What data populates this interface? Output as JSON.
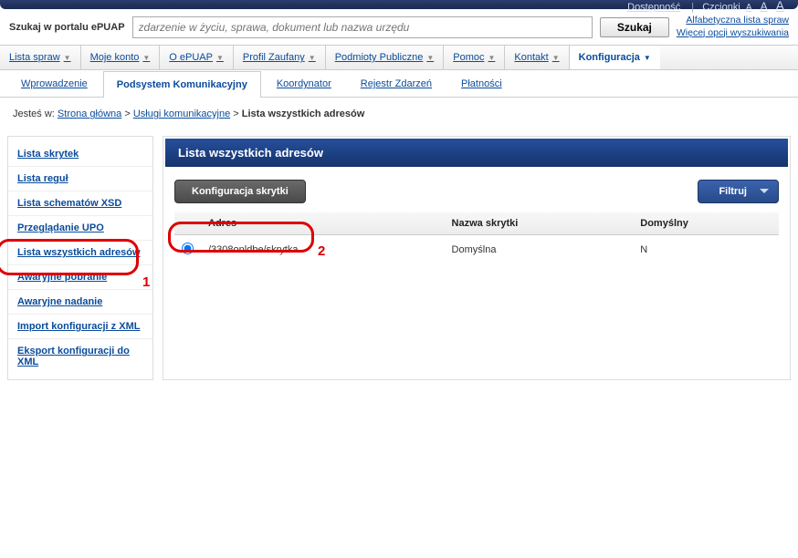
{
  "top": {
    "accessibility": "Dostępność",
    "fonts": "Czcionki",
    "font_a1": "A",
    "font_a2": "A",
    "font_a3": "A"
  },
  "search": {
    "label": "Szukaj w portalu ePUAP",
    "placeholder": "zdarzenie w życiu, sprawa, dokument lub nazwa urzędu",
    "button": "Szukaj",
    "alpha": "Alfabetyczna lista spraw",
    "more": "Więcej opcji wyszukiwania"
  },
  "nav1": {
    "items": [
      "Lista spraw",
      "Moje konto",
      "O ePUAP",
      "Profil Zaufany",
      "Podmioty Publiczne",
      "Pomoc",
      "Kontakt",
      "Konfiguracja"
    ]
  },
  "nav2": {
    "items": [
      "Wprowadzenie",
      "Podsystem Komunikacyjny",
      "Koordynator",
      "Rejestr Zdarzeń",
      "Płatności"
    ]
  },
  "breadcrumb": {
    "prefix": "Jesteś w:",
    "home": "Strona główna",
    "mid": "Usługi komunikacyjne",
    "current": "Lista wszystkich adresów"
  },
  "sidebar": {
    "items": [
      "Lista skrytek",
      "Lista reguł",
      "Lista schematów XSD",
      "Przeglądanie UPO",
      "Lista wszystkich adresów",
      "Awaryjne pobranie",
      "Awaryjne nadanie",
      "Import konfiguracji z XML",
      "Eksport konfiguracji do XML"
    ]
  },
  "panel": {
    "title": "Lista wszystkich adresów",
    "config_btn": "Konfiguracja skrytki",
    "filter_btn": "Filtruj"
  },
  "table": {
    "headers": {
      "col1": "Adres",
      "col2": "Nazwa skrytki",
      "col3": "Domyślny"
    },
    "rows": [
      {
        "address": "/3308onldbe/skrytka",
        "name": "Domyślna",
        "default": "N"
      }
    ]
  },
  "annotations": {
    "one": "1",
    "two": "2"
  },
  "sep": ">"
}
